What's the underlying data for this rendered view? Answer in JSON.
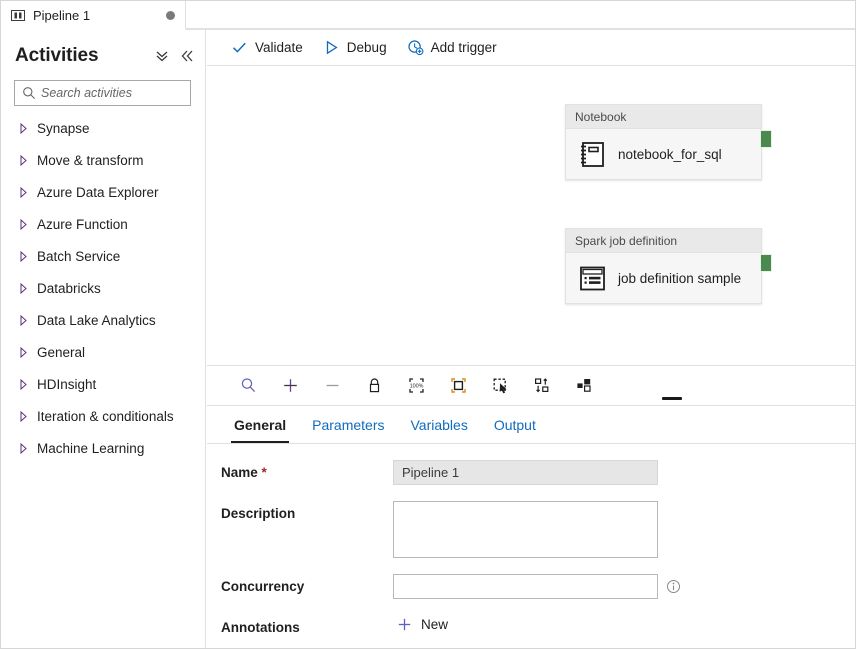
{
  "tab": {
    "label": "Pipeline 1",
    "icon": "pipeline-icon",
    "dirty_dot": "unsaved-indicator"
  },
  "sidebar": {
    "title": "Activities",
    "collapse_all_icon": "double-chevron-down-icon",
    "collapse_panel_icon": "double-chevron-left-icon",
    "search": {
      "placeholder": "Search activities",
      "value": "",
      "icon": "search-icon"
    },
    "items": [
      {
        "label": "Synapse"
      },
      {
        "label": "Move & transform"
      },
      {
        "label": "Azure Data Explorer"
      },
      {
        "label": "Azure Function"
      },
      {
        "label": "Batch Service"
      },
      {
        "label": "Databricks"
      },
      {
        "label": "Data Lake Analytics"
      },
      {
        "label": "General"
      },
      {
        "label": "HDInsight"
      },
      {
        "label": "Iteration & conditionals"
      },
      {
        "label": "Machine Learning"
      }
    ]
  },
  "toolbar": {
    "validate_label": "Validate",
    "validate_icon": "checkmark-icon",
    "debug_label": "Debug",
    "debug_icon": "play-icon",
    "add_trigger_label": "Add trigger",
    "add_trigger_icon": "clock-plus-icon"
  },
  "canvas": {
    "nodes": [
      {
        "type": "Notebook",
        "name": "notebook_for_sql",
        "icon": "notebook-icon",
        "connector": "output-connector"
      },
      {
        "type": "Spark job definition",
        "name": "job definition sample",
        "icon": "spark-job-definition-icon",
        "connector": "output-connector"
      }
    ],
    "controls": [
      {
        "name": "zoom-search-icon"
      },
      {
        "name": "zoom-in-icon"
      },
      {
        "name": "zoom-out-icon"
      },
      {
        "name": "lock-icon"
      },
      {
        "name": "zoom-100-percent-icon"
      },
      {
        "name": "fit-to-screen-icon"
      },
      {
        "name": "marquee-select-icon"
      },
      {
        "name": "auto-align-icon"
      },
      {
        "name": "grouping-icon"
      }
    ],
    "zoom_level_label": "100%"
  },
  "properties": {
    "tabs": [
      {
        "label": "General",
        "active": true
      },
      {
        "label": "Parameters",
        "active": false
      },
      {
        "label": "Variables",
        "active": false
      },
      {
        "label": "Output",
        "active": false
      }
    ],
    "fields": {
      "name_label": "Name",
      "name_required": "*",
      "name_value": "Pipeline 1",
      "description_label": "Description",
      "description_value": "",
      "concurrency_label": "Concurrency",
      "concurrency_value": "",
      "concurrency_info_icon": "info-icon",
      "annotations_label": "Annotations",
      "annotations_new_label": "New",
      "annotations_new_icon": "plus-icon"
    }
  },
  "colors": {
    "accent_blue": "#0f6cbd",
    "connector_green": "#4a8a4f",
    "required_red": "#a4262c",
    "fit_orange": "#d98b1e"
  }
}
